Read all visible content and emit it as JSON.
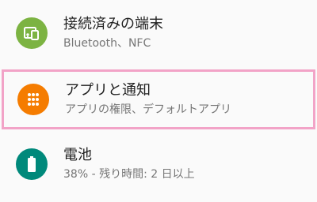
{
  "settings": {
    "items": [
      {
        "title": "接続済みの端末",
        "subtitle": "Bluetooth、NFC",
        "icon": "connected-devices-icon",
        "color": "#7cb342"
      },
      {
        "title": "アプリと通知",
        "subtitle": "アプリの権限、デフォルトアプリ",
        "icon": "apps-grid-icon",
        "color": "#f57c00"
      },
      {
        "title": "電池",
        "subtitle": "38% - 残り時間: 2 日以上",
        "icon": "battery-icon",
        "color": "#00897b"
      }
    ]
  },
  "highlight_color": "#f2a3c7"
}
